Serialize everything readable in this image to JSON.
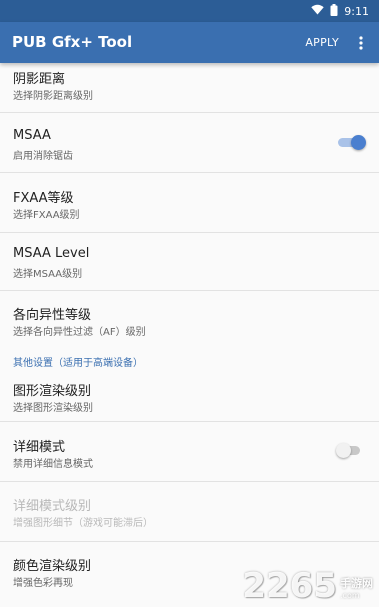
{
  "status_bar": {
    "time": "9:11",
    "wifi_icon": "wifi-icon",
    "battery_icon": "battery-icon"
  },
  "app_bar": {
    "title": "PUB Gfx+ Tool",
    "apply_label": "APPLY",
    "overflow_icon": "more-vert-icon"
  },
  "colors": {
    "primary": "#3a6fb0",
    "status_bar": "#2c5d96",
    "accent": "#4a7fcf"
  },
  "prefs": {
    "shadow_distance": {
      "title": "阴影距离",
      "summary": "选择阴影距离级别"
    },
    "msaa": {
      "title": "MSAA",
      "summary": "启用消除锯齿",
      "enabled": true
    },
    "fxaa": {
      "title": "FXAA等级",
      "summary": "选择FXAA级别"
    },
    "msaa_level": {
      "title": "MSAA Level",
      "summary": "选择MSAA级别"
    },
    "anisotropic": {
      "title": "各向异性等级",
      "summary": "选择各向异性过滤（AF）级别"
    },
    "category_other": "其他设置（适用于高端设备）",
    "render_level": {
      "title": "图形渲染级别",
      "summary": "选择图形渲染级别"
    },
    "detail_mode": {
      "title": "详细模式",
      "summary": "禁用详细信息模式",
      "enabled": false
    },
    "detail_mode_level": {
      "title": "详细模式级别",
      "summary": "增强图形细节（游戏可能滞后）"
    },
    "color_render": {
      "title": "颜色渲染级别",
      "summary": "增强色彩再现"
    }
  },
  "watermark": {
    "number": "2265",
    "label": "手游网",
    "url": ".com"
  }
}
